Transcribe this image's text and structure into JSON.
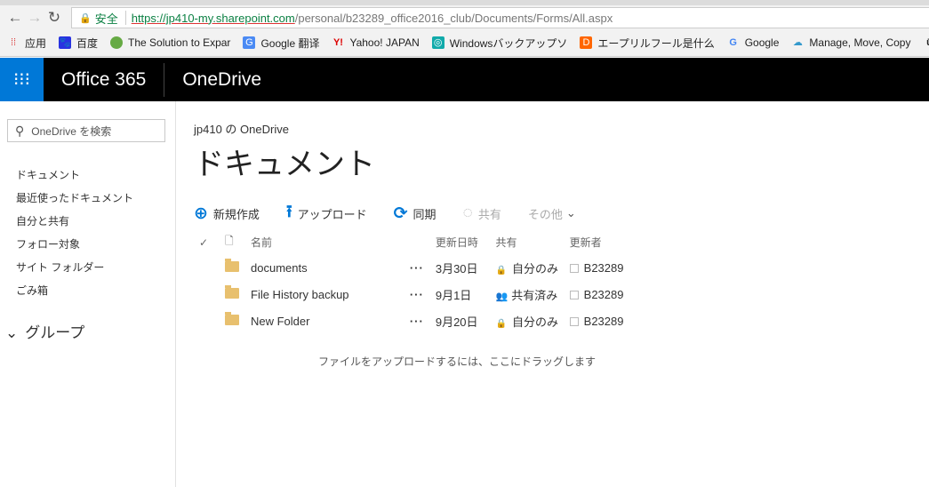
{
  "browser": {
    "secure_label": "安全",
    "url_host": "https://jp410-my.sharepoint.com",
    "url_path": "/personal/b23289_office2016_club/Documents/Forms/All.aspx",
    "bookmarks": [
      {
        "icon": "apps-icon",
        "label": "应用"
      },
      {
        "icon": "baidu-icon",
        "label": "百度"
      },
      {
        "icon": "globe-icon",
        "label": "The Solution to Expar"
      },
      {
        "icon": "google-translate-icon",
        "label": "Google 翻译"
      },
      {
        "icon": "yahoo-icon",
        "label": "Yahoo! JAPAN"
      },
      {
        "icon": "windows-icon",
        "label": "Windowsバックアップソ"
      },
      {
        "icon": "d-icon",
        "label": "エープリルフール是什么"
      },
      {
        "icon": "google-icon",
        "label": "Google"
      },
      {
        "icon": "cloud-icon",
        "label": "Manage, Move, Copy"
      },
      {
        "icon": "u-icon",
        "label": "U"
      }
    ]
  },
  "suite": {
    "office": "Office 365",
    "app": "OneDrive"
  },
  "sidebar": {
    "search_placeholder": "OneDrive を検索",
    "items": [
      "ドキュメント",
      "最近使ったドキュメント",
      "自分と共有",
      "フォロー対象",
      "サイト フォルダー",
      "ごみ箱"
    ],
    "group": "グループ"
  },
  "main": {
    "breadcrumb": "jp410 の OneDrive",
    "title": "ドキュメント",
    "commands": {
      "new": "新規作成",
      "upload": "アップロード",
      "sync": "同期",
      "share": "共有",
      "more": "その他"
    },
    "columns": {
      "name": "名前",
      "modified": "更新日時",
      "sharing": "共有",
      "modified_by": "更新者"
    },
    "rows": [
      {
        "name": "documents",
        "modified": "3月30日",
        "sharing": "自分のみ",
        "sharing_icon": "lock-icon",
        "modified_by": "B23289"
      },
      {
        "name": "File History backup",
        "modified": "9月1日",
        "sharing": "共有済み",
        "sharing_icon": "people-icon",
        "modified_by": "B23289"
      },
      {
        "name": "New Folder",
        "modified": "9月20日",
        "sharing": "自分のみ",
        "sharing_icon": "lock-icon",
        "modified_by": "B23289"
      }
    ],
    "drop_hint": "ファイルをアップロードするには、ここにドラッグします"
  }
}
